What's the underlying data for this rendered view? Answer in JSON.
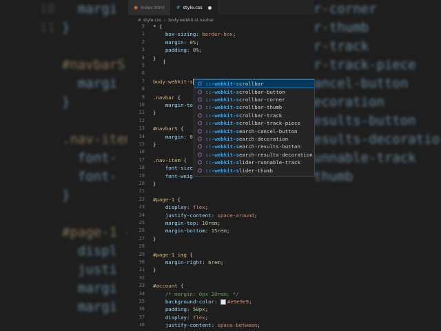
{
  "tabs": [
    {
      "label": "index.html",
      "icon": "html-file-icon",
      "active": false
    },
    {
      "label": "style.css",
      "icon": "css-file-icon",
      "active": true,
      "modified": true
    }
  ],
  "breadcrumb": {
    "file": "style.css",
    "symbol": "body:webkit-sl.navbar"
  },
  "code_lines": [
    {
      "n": "5",
      "html": "<span class=\"pun\">* {</span>"
    },
    {
      "n": "1",
      "html": "    <span class=\"prop\">box-sizing</span>: <span class=\"val\">border-box</span>;"
    },
    {
      "n": "2",
      "html": "    <span class=\"prop\">margin</span>: <span class=\"num\">0%</span>;"
    },
    {
      "n": "3",
      "html": "    <span class=\"prop\">padding</span>: <span class=\"num\">0%</span>;"
    },
    {
      "n": "4",
      "html": "<span class=\"pun\">}</span>"
    },
    {
      "n": "5",
      "html": ""
    },
    {
      "n": "6",
      "html": ""
    },
    {
      "n": "7",
      "html": "<span class=\"sel\">body</span>:<span class=\"sel\">webkit-s</span><span class=\"cursor\"></span>"
    },
    {
      "n": "8",
      "html": ""
    },
    {
      "n": "9",
      "html": "<span class=\"sel\">.navbar</span> {"
    },
    {
      "n": "10",
      "html": "    <span class=\"prop\">margin-to</span>"
    },
    {
      "n": "11",
      "html": "}"
    },
    {
      "n": "12",
      "html": ""
    },
    {
      "n": "13",
      "html": "<span class=\"sel\">#navbarS</span> {"
    },
    {
      "n": "14",
      "html": "    <span class=\"prop\">margin</span>: <span class=\"num\">0</span>"
    },
    {
      "n": "15",
      "html": "}"
    },
    {
      "n": "16",
      "html": ""
    },
    {
      "n": "17",
      "html": "<span class=\"sel\">.nav-item</span> {"
    },
    {
      "n": "18",
      "html": "    <span class=\"prop\">font-size</span>"
    },
    {
      "n": "19",
      "html": "    <span class=\"prop\">font-weig</span>"
    },
    {
      "n": "20",
      "html": "}"
    },
    {
      "n": "21",
      "html": ""
    },
    {
      "n": "22",
      "html": "<span class=\"sel\">#page-1</span> {"
    },
    {
      "n": "23",
      "html": "    <span class=\"prop\">display</span>: <span class=\"val\">flex</span>;"
    },
    {
      "n": "24",
      "html": "    <span class=\"prop\">justify-content</span>: <span class=\"val\">space-around</span>;"
    },
    {
      "n": "25",
      "html": "    <span class=\"prop\">margin-top</span>: <span class=\"num\">10rem</span>;"
    },
    {
      "n": "26",
      "html": "    <span class=\"prop\">margin-bottom</span>: <span class=\"num\">15rem</span>;"
    },
    {
      "n": "27",
      "html": "}"
    },
    {
      "n": "28",
      "html": ""
    },
    {
      "n": "29",
      "html": "<span class=\"sel\">#page-1 img</span> {"
    },
    {
      "n": "30",
      "html": "    <span class=\"prop\">margin-right</span>: <span class=\"num\">6rem</span>;"
    },
    {
      "n": "31",
      "html": "}"
    },
    {
      "n": "32",
      "html": ""
    },
    {
      "n": "33",
      "html": "<span class=\"sel\">#account</span> {"
    },
    {
      "n": "34",
      "html": "    <span class=\"cmt\">/* margin: 0px 30rem; */</span>"
    },
    {
      "n": "35",
      "html": "    <span class=\"prop\">background-color</span>: <span class=\"swatch\"></span><span class=\"val\">#e9e9e9</span>;"
    },
    {
      "n": "36",
      "html": "    <span class=\"prop\">padding</span>: <span class=\"num\">50px</span>;"
    },
    {
      "n": "37",
      "html": "    <span class=\"prop\">display</span>: <span class=\"val\">flex</span>;"
    },
    {
      "n": "38",
      "html": "    <span class=\"prop\">justify-content</span>: <span class=\"val\">space-between</span>;"
    },
    {
      "n": "39",
      "html": "}"
    }
  ],
  "suggestions": [
    {
      "match": "::-webkit-s",
      "rest": "crollbar",
      "selected": true
    },
    {
      "match": "::-webkit-s",
      "rest": "crollbar-button"
    },
    {
      "match": "::-webkit-s",
      "rest": "crollbar-corner"
    },
    {
      "match": "::-webkit-s",
      "rest": "crollbar-thumb"
    },
    {
      "match": "::-webkit-s",
      "rest": "crollbar-track"
    },
    {
      "match": "::-webkit-s",
      "rest": "crollbar-track-piece"
    },
    {
      "match": "::-webkit-s",
      "rest": "earch-cancel-button"
    },
    {
      "match": "::-webkit-s",
      "rest": "earch-decoration"
    },
    {
      "match": "::-webkit-s",
      "rest": "earch-results-button"
    },
    {
      "match": "::-webkit-s",
      "rest": "earch-results-decoration"
    },
    {
      "match": "::-webkit-s",
      "rest": "lider-runnable-track"
    },
    {
      "match": "::-webkit-s",
      "rest": "lider-thumb"
    }
  ],
  "background_left": [
    {
      "n": "10",
      "t": "  margi"
    },
    {
      "n": "11",
      "t": "}"
    },
    {
      "n": "",
      "t": ""
    },
    {
      "n": "",
      "t": "#navbarS"
    },
    {
      "n": "",
      "t": "  margi"
    },
    {
      "n": "",
      "t": "}"
    },
    {
      "n": "",
      "t": ""
    },
    {
      "n": "",
      "t": ".nav-item"
    },
    {
      "n": "",
      "t": "  font-"
    },
    {
      "n": "",
      "t": "  font-"
    },
    {
      "n": "",
      "t": "}"
    },
    {
      "n": "",
      "t": ""
    },
    {
      "n": "",
      "t": "#page-1 {"
    },
    {
      "n": "",
      "t": "  displ"
    },
    {
      "n": "",
      "t": "  justi"
    },
    {
      "n": "",
      "t": "  margi"
    },
    {
      "n": "",
      "t": "  margi"
    }
  ],
  "background_right": [
    "r-corner",
    "r-thumb",
    "r-track",
    "r-track-piece",
    "ancel-button",
    "ecoration",
    "esults-button",
    "esults-decoration",
    "unnable-track",
    "thumb"
  ]
}
